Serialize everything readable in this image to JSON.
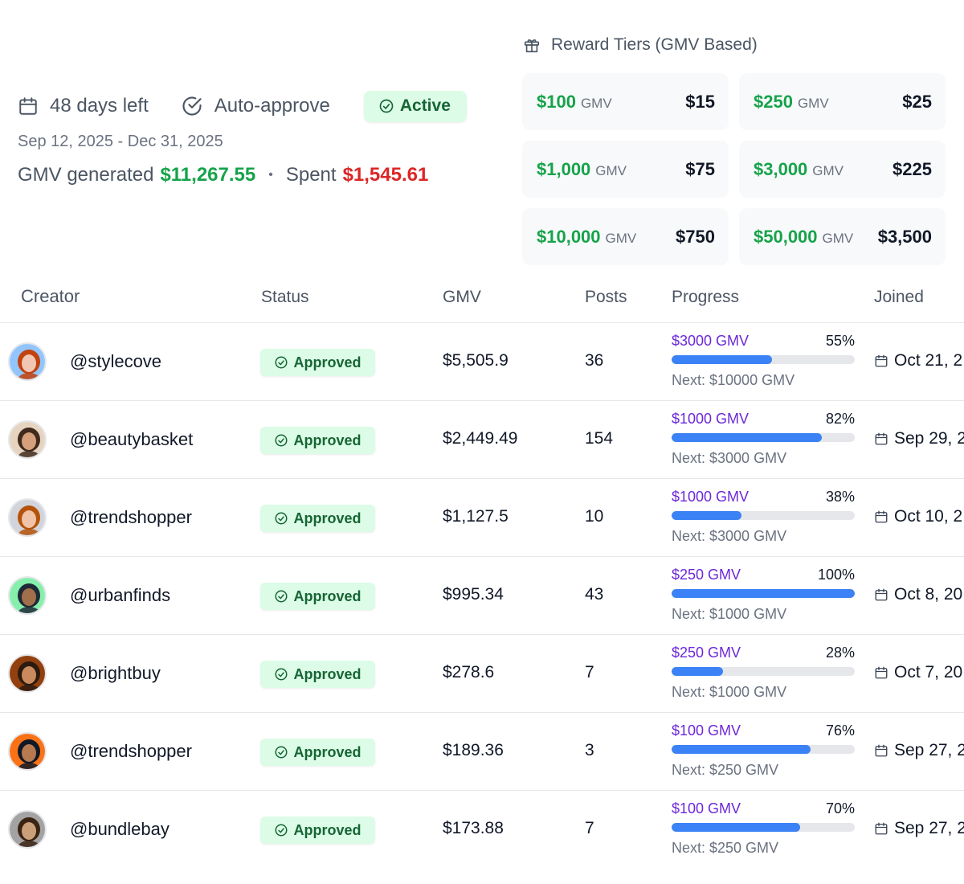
{
  "summary": {
    "days_left": "48 days left",
    "auto_approve": "Auto-approve",
    "status": "Active",
    "date_range": "Sep 12, 2025 - Dec 31, 2025",
    "gmv_label": "GMV generated",
    "gmv_value": "$11,267.55",
    "separator": "•",
    "spent_label": "Spent",
    "spent_value": "$1,545.61"
  },
  "tiers": {
    "title": "Reward Tiers (GMV Based)",
    "unit": "GMV",
    "items": [
      {
        "gmv": "$100",
        "reward": "$15"
      },
      {
        "gmv": "$250",
        "reward": "$25"
      },
      {
        "gmv": "$1,000",
        "reward": "$75"
      },
      {
        "gmv": "$3,000",
        "reward": "$225"
      },
      {
        "gmv": "$10,000",
        "reward": "$750"
      },
      {
        "gmv": "$50,000",
        "reward": "$3,500"
      }
    ]
  },
  "table": {
    "headers": {
      "creator": "Creator",
      "status": "Status",
      "gmv": "GMV",
      "posts": "Posts",
      "progress": "Progress",
      "joined": "Joined"
    },
    "rows": [
      {
        "handle": "@stylecove",
        "status": "Approved",
        "gmv": "$5,505.9",
        "posts": "36",
        "tier": "$3000 GMV",
        "pct": "55%",
        "progress": 0.55,
        "next": "Next: $10000 GMV",
        "joined": "Oct 21, 2"
      },
      {
        "handle": "@beautybasket",
        "status": "Approved",
        "gmv": "$2,449.49",
        "posts": "154",
        "tier": "$1000 GMV",
        "pct": "82%",
        "progress": 0.82,
        "next": "Next: $3000 GMV",
        "joined": "Sep 29, 2"
      },
      {
        "handle": "@trendshopper",
        "status": "Approved",
        "gmv": "$1,127.5",
        "posts": "10",
        "tier": "$1000 GMV",
        "pct": "38%",
        "progress": 0.38,
        "next": "Next: $3000 GMV",
        "joined": "Oct 10, 2"
      },
      {
        "handle": "@urbanfinds",
        "status": "Approved",
        "gmv": "$995.34",
        "posts": "43",
        "tier": "$250 GMV",
        "pct": "100%",
        "progress": 1.0,
        "next": "Next: $1000 GMV",
        "joined": "Oct 8, 20"
      },
      {
        "handle": "@brightbuy",
        "status": "Approved",
        "gmv": "$278.6",
        "posts": "7",
        "tier": "$250 GMV",
        "pct": "28%",
        "progress": 0.28,
        "next": "Next: $1000 GMV",
        "joined": "Oct 7, 20"
      },
      {
        "handle": "@trendshopper",
        "status": "Approved",
        "gmv": "$189.36",
        "posts": "3",
        "tier": "$100 GMV",
        "pct": "76%",
        "progress": 0.76,
        "next": "Next: $250 GMV",
        "joined": "Sep 27, 2"
      },
      {
        "handle": "@bundlebay",
        "status": "Approved",
        "gmv": "$173.88",
        "posts": "7",
        "tier": "$100 GMV",
        "pct": "70%",
        "progress": 0.7,
        "next": "Next: $250 GMV",
        "joined": "Sep 27, 2"
      }
    ]
  },
  "colors": {
    "accent_green": "#16a34a",
    "spent_red": "#dc2626",
    "tier_purple": "#6d28d9",
    "progress_blue": "#3b82f6",
    "badge_bg": "#dcfce7"
  },
  "avatars": [
    {
      "skin": "#f1c7b4",
      "hair": "#c2410c",
      "bg": "#93c5fd"
    },
    {
      "skin": "#d6a07c",
      "hair": "#3f2a1d",
      "bg": "#e7d4c0"
    },
    {
      "skin": "#f0c4a8",
      "hair": "#b45309",
      "bg": "#d1d5db"
    },
    {
      "skin": "#a16f4a",
      "hair": "#1f2937",
      "bg": "#86efac"
    },
    {
      "skin": "#c98a5e",
      "hair": "#2b1a10",
      "bg": "#92400e"
    },
    {
      "skin": "#b77950",
      "hair": "#111827",
      "bg": "#f97316"
    },
    {
      "skin": "#caa07a",
      "hair": "#3b2314",
      "bg": "#a3a3a3"
    }
  ]
}
